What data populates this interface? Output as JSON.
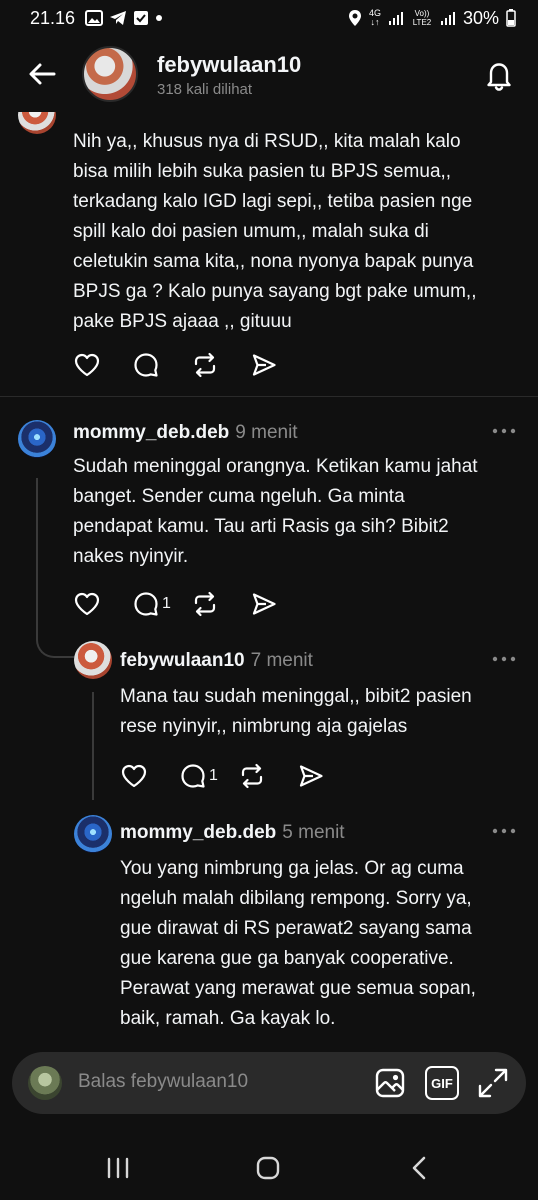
{
  "status_bar": {
    "time": "21.16",
    "network_top": "4G",
    "volte_label": "Vo)) LTE2",
    "battery": "30%"
  },
  "header": {
    "username": "febywulaan10",
    "views": "318 kali dilihat"
  },
  "posts": [
    {
      "text_lines": [
        "Nih ya,, khusus nya di RSUD,, kita malah kalo",
        "bisa milih lebih suka pasien tu BPJS semua,,",
        "terkadang kalo IGD lagi sepi,, tetiba pasien nge",
        "spill kalo doi pasien umum,, malah suka di",
        "celetukin sama kita,, nona nyonya bapak punya",
        "BPJS ga ? Kalo punya sayang bgt pake umum,,",
        "pake BPJS ajaaa ,, gituuu"
      ]
    },
    {
      "username": "mommy_deb.deb",
      "time": "9 menit",
      "text_lines": [
        "Sudah meninggal orangnya. Ketikan kamu jahat",
        "banget. Sender cuma ngeluh. Ga minta",
        "pendapat kamu. Tau arti Rasis ga sih? Bibit2",
        "nakes nyinyir."
      ],
      "reply_count": "1"
    },
    {
      "username": "febywulaan10",
      "time": "7 menit",
      "text_lines": [
        "Mana tau sudah meninggal,, bibit2 pasien",
        "rese nyinyir,, nimbrung aja gajelas"
      ],
      "reply_count": "1"
    },
    {
      "username": "mommy_deb.deb",
      "time": "5 menit",
      "text_lines": [
        "You yang nimbrung ga jelas. Or ag cuma",
        "ngeluh malah dibilang rempong. Sorry ya,",
        "gue dirawat di RS perawat2 sayang sama",
        "gue karena gue ga banyak cooperative.",
        "Perawat yang merawat gue semua sopan,",
        "baik, ramah. Ga kayak lo."
      ]
    }
  ],
  "reply_bar": {
    "placeholder": "Balas febywulaan10",
    "gif_label": "GIF"
  },
  "icons": {
    "back": "arrow-left-icon",
    "bell": "bell-icon",
    "like": "heart-icon",
    "comment": "comment-icon",
    "repost": "repost-icon",
    "share": "send-icon",
    "more": "more-dots-icon",
    "gallery": "image-icon",
    "gif": "gif-icon",
    "expand": "expand-icon"
  },
  "colors": {
    "background": "#101010",
    "text": "#f3f5f7",
    "muted": "#8a8a8a",
    "input": "#2a2a2a"
  }
}
